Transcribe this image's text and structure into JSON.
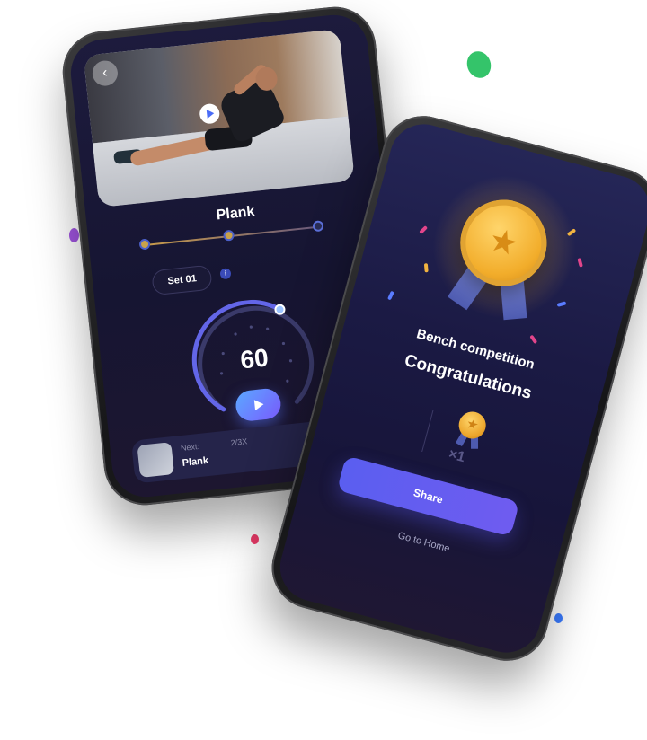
{
  "workout_screen": {
    "back_icon": "chevron-left-icon",
    "exercise_title": "Plank",
    "set_label": "Set 01",
    "info_icon": "i",
    "timer_value": "60",
    "next": {
      "label": "Next:",
      "count": "2/3X",
      "name": "Plank",
      "arrow_icon": "chevron-right-icon"
    }
  },
  "achievement_screen": {
    "event_title": "Bench competition",
    "congrats_text": "Congratulations",
    "medal_count": "×1",
    "share_label": "Share",
    "home_label": "Go to Home"
  },
  "colors": {
    "accent": "#5a5ef0",
    "gold": "#f2ad2b",
    "screen_bg": "#1b1a44"
  }
}
